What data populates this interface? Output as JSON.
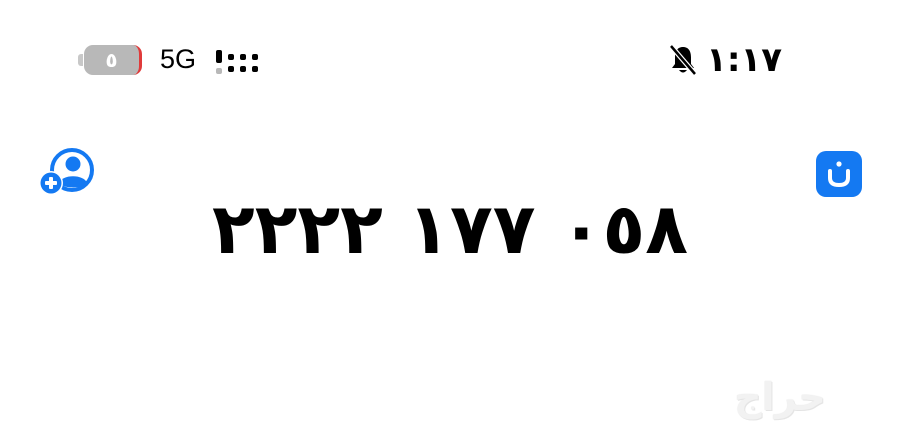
{
  "status_bar": {
    "battery_level": "٥",
    "network": "5G",
    "time": "١:١٧",
    "icons": [
      "battery-icon",
      "signal-icon",
      "bell-muted-icon"
    ]
  },
  "contact": {
    "phone_number": "٠٥٨ ١٧٧ ٢٢٢٢",
    "add_contact_icon": "add-contact-icon",
    "app_icon": "nun-app-icon",
    "app_icon_letter": "ن"
  },
  "watermark": {
    "text": "حراج"
  },
  "colors": {
    "accent": "#1479f2",
    "battery_low": "#e03a3a",
    "background": "#ffffff",
    "text": "#000000"
  }
}
